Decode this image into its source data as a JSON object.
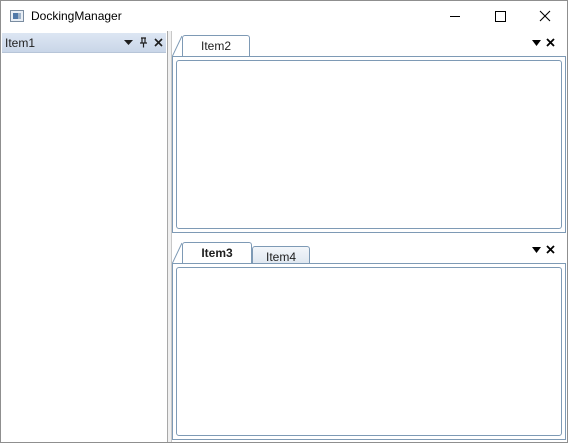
{
  "window": {
    "title": "DockingManager",
    "icons": {
      "app": "app-window-icon",
      "minimize": "minimize-icon",
      "maximize": "maximize-icon",
      "close": "close-icon"
    }
  },
  "left_pane": {
    "header": "Item1",
    "icons": [
      "dropdown-arrow-icon",
      "pin-icon",
      "close-icon"
    ]
  },
  "top_group": {
    "tabs": [
      {
        "label": "Item2",
        "active": true
      }
    ],
    "icons": [
      "dropdown-arrow-icon",
      "close-icon"
    ]
  },
  "bottom_group": {
    "tabs": [
      {
        "label": "Item3",
        "active": true
      },
      {
        "label": "Item4",
        "active": false
      }
    ],
    "icons": [
      "dropdown-arrow-icon",
      "close-icon"
    ]
  },
  "colors": {
    "header_gradient_top": "#dde6f3",
    "header_gradient_bottom": "#c9d6e8",
    "tab_border": "#7e9ab5"
  }
}
